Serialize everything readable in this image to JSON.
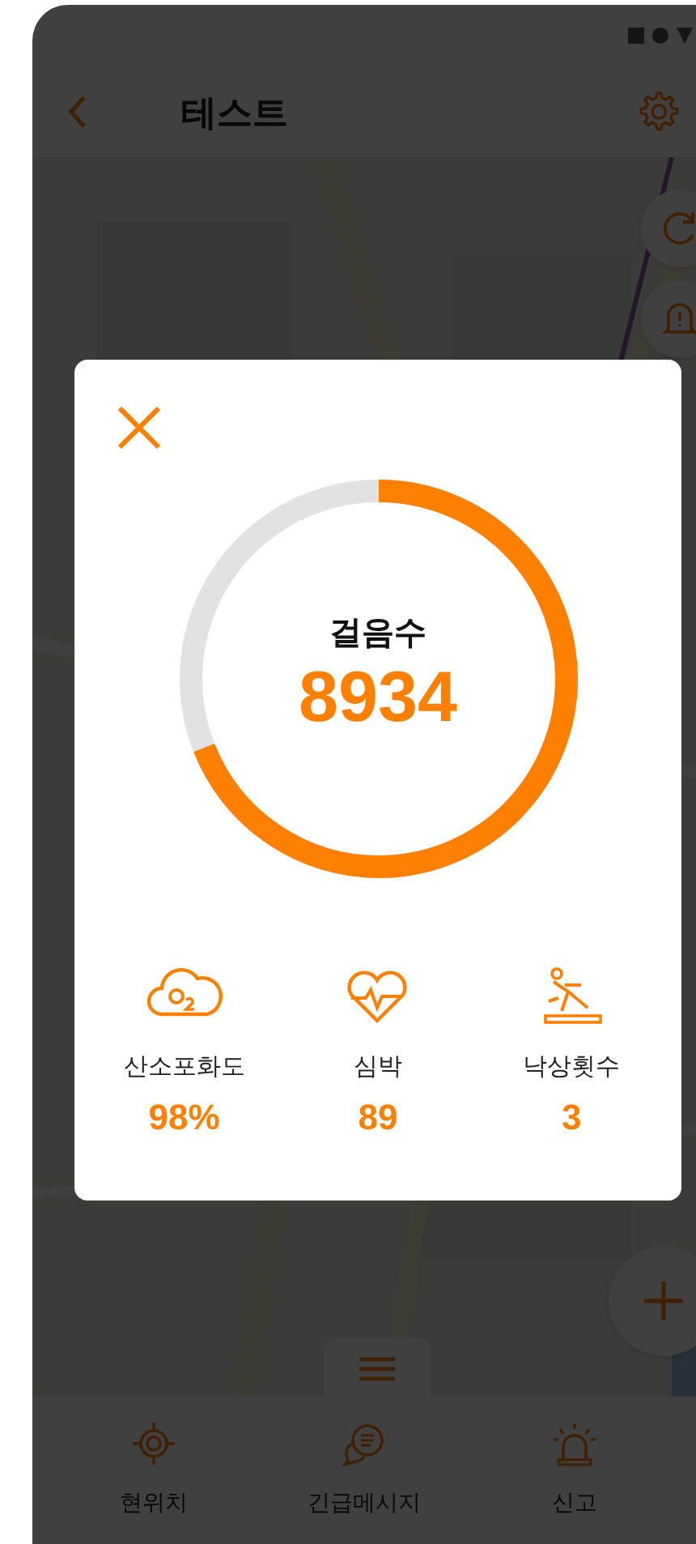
{
  "header": {
    "title": "테스트"
  },
  "steps_dialog": {
    "title": "걸음수",
    "value": "8934",
    "level": 0.69,
    "stats": [
      {
        "kind": "oxygen",
        "label": "산소포화도",
        "value": "98%"
      },
      {
        "kind": "heart",
        "label": "심박",
        "value": "89"
      },
      {
        "kind": "fall",
        "label": "낙상횟수",
        "value": "3"
      }
    ]
  },
  "bottom_nav": [
    {
      "kind": "location",
      "label": "현위치"
    },
    {
      "kind": "message",
      "label": "긴급메시지"
    },
    {
      "kind": "alarm",
      "label": "신고"
    }
  ]
}
